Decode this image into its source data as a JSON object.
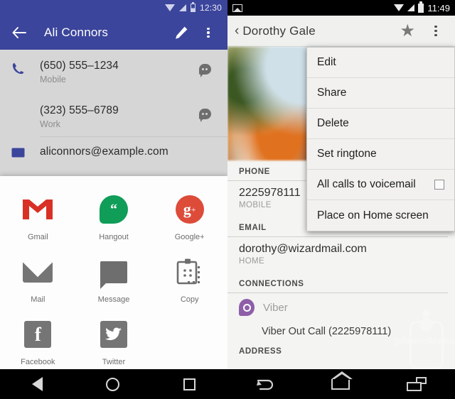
{
  "left_phone": {
    "status_bar": {
      "time": "12:30",
      "icons": [
        "wifi-icon",
        "signal-icon",
        "battery-icon"
      ]
    },
    "app_bar": {
      "back_label": "←",
      "title": "Ali Connors",
      "edit_icon": "pencil-icon",
      "overflow_icon": "overflow-menu-icon"
    },
    "contact": {
      "rows": [
        {
          "primary": "(650) 555–1234",
          "secondary": "Mobile",
          "lead_icon": "phone-icon",
          "trail_icon": "hangouts-bubble-icon"
        },
        {
          "primary": "(323) 555–6789",
          "secondary": "Work",
          "lead_icon": "",
          "trail_icon": "hangouts-bubble-icon"
        },
        {
          "primary": "aliconnors@example.com",
          "secondary": "",
          "lead_icon": "email-icon",
          "trail_icon": ""
        }
      ]
    },
    "share_sheet": {
      "apps": [
        {
          "label": "Gmail",
          "icon": "gmail-icon"
        },
        {
          "label": "Hangout",
          "icon": "hangouts-icon"
        },
        {
          "label": "Google+",
          "icon": "googleplus-icon"
        },
        {
          "label": "Mail",
          "icon": "mail-icon"
        },
        {
          "label": "Message",
          "icon": "message-icon"
        },
        {
          "label": "Copy",
          "icon": "clipboard-copy-icon"
        },
        {
          "label": "Facebook",
          "icon": "facebook-icon"
        },
        {
          "label": "Twitter",
          "icon": "twitter-icon"
        }
      ]
    },
    "nav_bar": {
      "back": "back-icon",
      "home": "home-icon",
      "recents": "recents-icon"
    }
  },
  "right_phone": {
    "status_bar": {
      "time": "11:49",
      "icons": [
        "photo-icon",
        "wifi-icon",
        "signal-icon",
        "battery-icon"
      ]
    },
    "app_bar": {
      "back_chevron": "‹",
      "title": "Dorothy Gale",
      "star_icon": "star-icon",
      "star_glyph": "★",
      "overflow_icon": "overflow-menu-icon"
    },
    "overflow_menu": {
      "items": [
        {
          "label": "Edit",
          "has_checkbox": false
        },
        {
          "label": "Share",
          "has_checkbox": false
        },
        {
          "label": "Delete",
          "has_checkbox": false
        },
        {
          "label": "Set ringtone",
          "has_checkbox": false
        },
        {
          "label": "All calls to voicemail",
          "has_checkbox": true,
          "checked": false
        },
        {
          "label": "Place on Home screen",
          "has_checkbox": false
        }
      ]
    },
    "sections": {
      "phone": {
        "header": "PHONE",
        "value": "2225978111",
        "type": "MOBILE"
      },
      "email": {
        "header": "EMAIL",
        "value": "dorothy@wizardmail.com",
        "type": "HOME"
      },
      "connections": {
        "header": "CONNECTIONS",
        "app_label": "Viber",
        "app_icon": "viber-icon",
        "action": "Viber Out Call (2225978111)"
      },
      "address": {
        "header": "ADDRESS"
      }
    },
    "nav_bar": {
      "back": "back-icon",
      "home": "home-icon",
      "recents": "recents-icon"
    },
    "watermark": {
      "text": "phoneArena"
    }
  },
  "colors": {
    "left_accent": "#3B459B",
    "left_body_bg": "#d6d6d6",
    "share_sheet_bg": "#fdfdfd",
    "right_appbar_bg": "#f0f0ee",
    "right_body_bg": "#f4f4f2",
    "menu_bg": "#f2f1ef",
    "gmail_red": "#dd4b39",
    "hangouts_green": "#0f9d58",
    "viber_purple": "#8e5ea8",
    "nav_bar_bg": "#000000"
  }
}
